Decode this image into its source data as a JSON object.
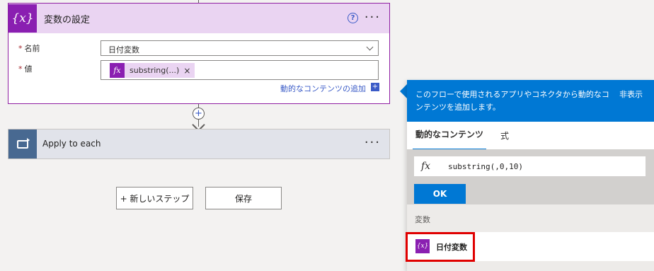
{
  "set_variable_card": {
    "icon_label": "{x}",
    "title": "変数の設定",
    "help_label": "?",
    "more_label": "···",
    "name_field": {
      "label": "名前",
      "value": "日付変数"
    },
    "value_field": {
      "label": "値",
      "token_icon": "fx",
      "token_text": "substring(...)",
      "token_remove": "×"
    },
    "required_marker": "*",
    "add_dynamic_link": "動的なコンテンツの追加",
    "add_dynamic_plus": "+"
  },
  "connector": {
    "plus_label": "+"
  },
  "apply_to_each": {
    "title": "Apply to each",
    "more_label": "···"
  },
  "actions": {
    "new_step": "+ 新しいステップ",
    "save": "保存"
  },
  "dynamic_panel": {
    "header_text": "このフローで使用されるアプリやコネクタから動的なコンテンツを追加します。",
    "hide_label": "非表示",
    "tabs": [
      {
        "label": "動的なコンテンツ",
        "active": true
      },
      {
        "label": "式",
        "active": false
      }
    ],
    "expression_icon": "fx",
    "expression": "substring(,0,10)",
    "ok_label": "OK",
    "section_label": "変数",
    "item": {
      "icon_label": "{x}",
      "label": "日付変数"
    }
  },
  "colors": {
    "variable_purple": "#8a1fb1",
    "card_header": "#ead4f2",
    "accent_blue": "#0078d4",
    "highlight_red": "#e00000",
    "loop_blue": "#486991"
  },
  "icons": [
    "variable-icon",
    "help-icon",
    "more-icon",
    "chevron-down-icon",
    "function-icon",
    "close-icon",
    "add-icon",
    "loop-icon"
  ]
}
